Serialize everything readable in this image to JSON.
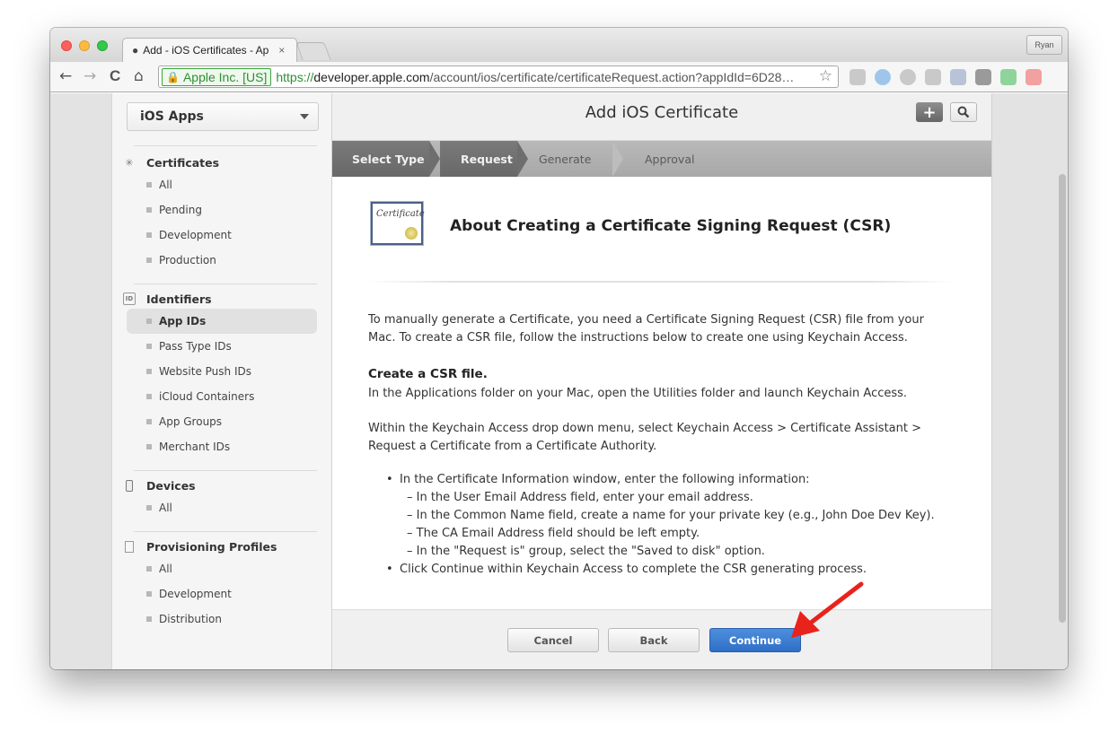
{
  "browser": {
    "tab_title": "Add - iOS Certificates - Ap",
    "tab_close": "×",
    "user_button": "Ryan",
    "ev_label": "Apple Inc. [US]",
    "url_scheme": "https://",
    "url_host": "developer.apple.com",
    "url_path": "/account/ios/certificate/certificateRequest.action?appIdId=6D28…",
    "back": "←",
    "forward": "→",
    "reload": "C",
    "home": "⌂",
    "star": "☆"
  },
  "sidebar": {
    "platform": "iOS Apps",
    "sections": [
      {
        "title": "Certificates",
        "icon": "certificate-badge-icon",
        "items": [
          "All",
          "Pending",
          "Development",
          "Production"
        ]
      },
      {
        "title": "Identifiers",
        "icon": "id-card-icon",
        "items": [
          "App IDs",
          "Pass Type IDs",
          "Website Push IDs",
          "iCloud Containers",
          "App Groups",
          "Merchant IDs"
        ],
        "active": "App IDs"
      },
      {
        "title": "Devices",
        "icon": "phone-device-icon",
        "items": [
          "All"
        ]
      },
      {
        "title": "Provisioning Profiles",
        "icon": "document-icon",
        "items": [
          "All",
          "Development",
          "Distribution"
        ]
      }
    ]
  },
  "main": {
    "title": "Add iOS Certificate",
    "add_button": "+",
    "steps": [
      "Select Type",
      "Request",
      "Generate",
      "Approval"
    ],
    "completed_steps": 2,
    "cert_icon_text": "Certificate",
    "heading": "About Creating a Certificate Signing Request (CSR)",
    "intro_line1": "To manually generate a Certificate, you need a Certificate Signing Request (CSR) file from your",
    "intro_line2": "Mac. To create a CSR file, follow the instructions below to create one using Keychain Access.",
    "create_heading": "Create a CSR file.",
    "create_text": "In the Applications folder on your Mac, open the Utilities folder and launch Keychain Access.",
    "menu_line1": "Within the Keychain Access drop down menu, select Keychain Access > Certificate Assistant >",
    "menu_line2": "Request a Certificate from a Certificate Authority.",
    "bullet1": "In the Certificate Information window, enter the following information:",
    "sub1": "– In the User Email Address field, enter your email address.",
    "sub2": "– In the Common Name field, create a name for your private key (e.g., John Doe Dev Key).",
    "sub3": "– The CA Email Address field should be left empty.",
    "sub4": "– In the \"Request is\" group, select the \"Saved to disk\" option.",
    "bullet2": "Click Continue within Keychain Access to complete the CSR generating process.",
    "bullet_char": "•",
    "buttons": {
      "cancel": "Cancel",
      "back": "Back",
      "continue": "Continue"
    }
  },
  "colors": {
    "continue_blue": "#3574cf",
    "annotation_red": "#e8231c",
    "ev_green": "#2f8f2f"
  }
}
